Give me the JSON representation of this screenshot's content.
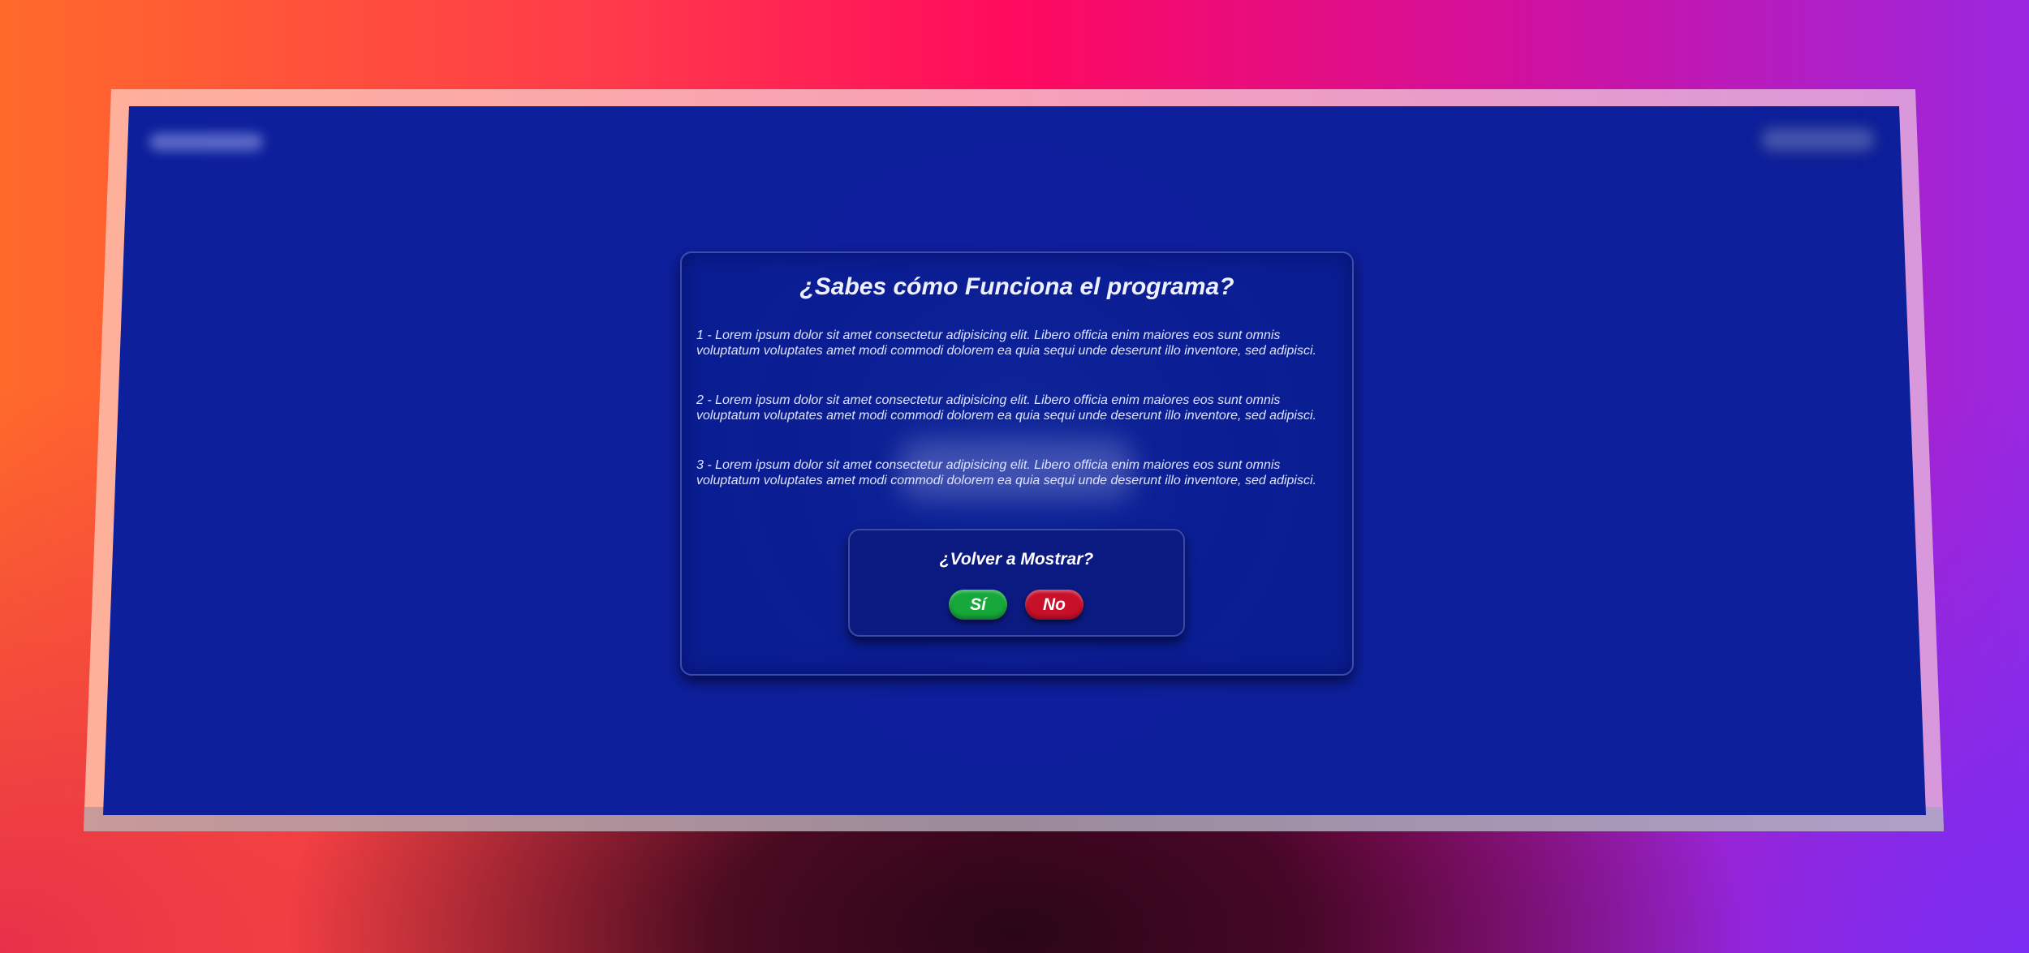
{
  "dialog": {
    "title": "¿Sabes cómo Funciona el programa?",
    "paragraphs": [
      "1 - Lorem ipsum dolor sit amet consectetur adipisicing elit. Libero officia enim maiores eos sunt omnis voluptatum voluptates amet modi commodi dolorem ea quia sequi unde deserunt illo inventore, sed adipisci.",
      "2 - Lorem ipsum dolor sit amet consectetur adipisicing elit. Libero officia enim maiores eos sunt omnis voluptatum voluptates amet modi commodi dolorem ea quia sequi unde deserunt illo inventore, sed adipisci.",
      "3 - Lorem ipsum dolor sit amet consectetur adipisicing elit. Libero officia enim maiores eos sunt omnis voluptatum voluptates amet modi commodi dolorem ea quia sequi unde deserunt illo inventore, sed adipisci."
    ],
    "prompt": {
      "title": "¿Volver a Mostrar?",
      "yes_label": "Sí",
      "no_label": "No"
    }
  },
  "colors": {
    "screen_bg": "#0d1f9b",
    "yes": "#16a83a",
    "no": "#c8102a"
  }
}
